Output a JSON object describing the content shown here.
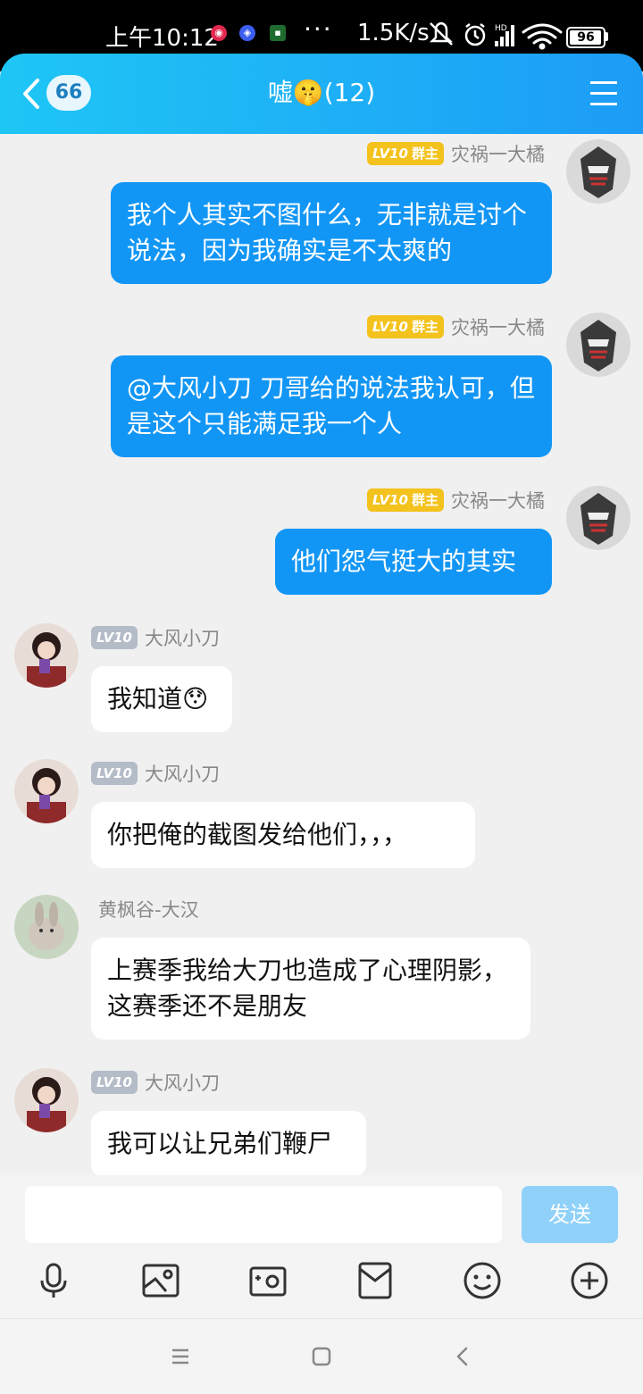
{
  "status": {
    "time": "上午10:12",
    "dots": "···",
    "speed": "1.5K/s",
    "battery": "96",
    "battery_level": 0.96
  },
  "header": {
    "unread_count": "66",
    "title": "嘘🤫(12)"
  },
  "messages": [
    {
      "side": "out",
      "level": "LV10",
      "role": "群主",
      "nick": "灾祸一大橘",
      "text": "我个人其实不图什么，无非就是讨个说法，因为我确实是不太爽的"
    },
    {
      "side": "out",
      "level": "LV10",
      "role": "群主",
      "nick": "灾祸一大橘",
      "text": "@大风小刀 刀哥给的说法我认可，但是这个只能满足我一个人"
    },
    {
      "side": "out",
      "level": "LV10",
      "role": "群主",
      "nick": "灾祸一大橘",
      "text": "他们怨气挺大的其实"
    },
    {
      "side": "in",
      "level": "LV10",
      "nick": "大风小刀",
      "text": "我知道😯"
    },
    {
      "side": "in",
      "level": "LV10",
      "nick": "大风小刀",
      "text": "你把俺的截图发给他们，，，"
    },
    {
      "side": "in",
      "nick": "黄枫谷-大汉",
      "text": "上赛季我给大刀也造成了心理阴影，这赛季还不是朋友"
    },
    {
      "side": "in",
      "level": "LV10",
      "nick": "大风小刀",
      "text": "我可以让兄弟们鞭尸"
    }
  ],
  "input": {
    "value": "",
    "send_label": "发送"
  },
  "colors": {
    "header_start": "#1ec6f5",
    "header_end": "#1d9cf6",
    "bubble_out": "#1296f5",
    "badge_owner": "#f3c21c",
    "badge_member": "#b4bcc8",
    "send_disabled": "#8fd1f9"
  },
  "icons": {
    "toolbar": [
      "microphone-icon",
      "image-icon",
      "camera-icon",
      "file-icon",
      "emoji-icon",
      "plus-icon"
    ],
    "nav": [
      "menu-lines-icon",
      "home-square-icon",
      "back-chevron-icon"
    ]
  }
}
